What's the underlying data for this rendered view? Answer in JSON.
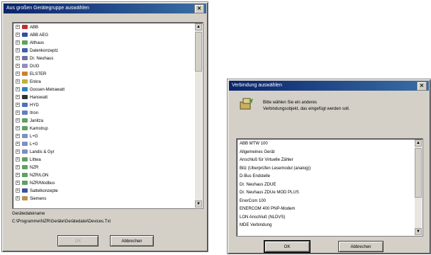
{
  "dialog_left": {
    "title": "Aus großen Gerätegruppe auswählen",
    "tree_items": [
      {
        "label": "ABB",
        "color": "#c03030"
      },
      {
        "label": "ABB AEG",
        "color": "#3050a0"
      },
      {
        "label": "Althaus",
        "color": "#60a060"
      },
      {
        "label": "Datenkonzeptz",
        "color": "#4060b0"
      },
      {
        "label": "Dr. Neuhaus",
        "color": "#7070a0"
      },
      {
        "label": "DUO",
        "color": "#9090c0"
      },
      {
        "label": "ELSTER",
        "color": "#d08030"
      },
      {
        "label": "Enkra",
        "color": "#c0b040"
      },
      {
        "label": "Gossen-Metrawatt",
        "color": "#3080c0"
      },
      {
        "label": "Hanswatt",
        "color": "#303030"
      },
      {
        "label": "HYD",
        "color": "#5070c0"
      },
      {
        "label": "Itron",
        "color": "#6080c0"
      },
      {
        "label": "Janitza",
        "color": "#60a060"
      },
      {
        "label": "Kamstrup",
        "color": "#60a060"
      },
      {
        "label": "L+G",
        "color": "#8090c0"
      },
      {
        "label": "L+G",
        "color": "#8090c0"
      },
      {
        "label": "Landis & Gyr",
        "color": "#8090c0"
      },
      {
        "label": "Littwa",
        "color": "#60a060"
      },
      {
        "label": "NZR",
        "color": "#60a060"
      },
      {
        "label": "NZR/LON",
        "color": "#60a060"
      },
      {
        "label": "NZR/Modbus",
        "color": "#60a060"
      },
      {
        "label": "Sattelkonzepte",
        "color": "#4050a0"
      },
      {
        "label": "Siemens",
        "color": "#c09050"
      }
    ],
    "path_label": "Gerätedateiname",
    "path_value": "C:\\Programme\\NZR\\Geräte\\Gerätedatei\\Devices.Txt",
    "ok_label": "OK",
    "cancel_label": "Abbrechen",
    "close_glyph": "×",
    "up_glyph": "▲",
    "down_glyph": "▼",
    "expand_glyph": "+"
  },
  "dialog_right": {
    "title": "Verbindung auswählen",
    "prompt_line1": "Bitte wählen Sie ein anderes",
    "prompt_line2": "Verbindungsobjekt, das eingefügt werden soll.",
    "list_items": [
      "ABB MTW 100",
      "Allgemeines Gerät",
      "Anschluß für Virtuelle Zähler",
      "Bitz (Überprüfen Lesemodul (analog))",
      "D-Bus Endstelle",
      "Dr. Neuhaus ZDUE",
      "Dr. Neuhaus ZDUe MOD PLUS",
      "EnerCom 100",
      "ENERCOM 400 PNP-Modem",
      "LON Anschluß (NLDVS)",
      "MDE Verbindung"
    ],
    "ok_label": "OK",
    "cancel_label": "Abbrechen",
    "close_glyph": "×",
    "up_glyph": "▲",
    "down_glyph": "▼"
  }
}
